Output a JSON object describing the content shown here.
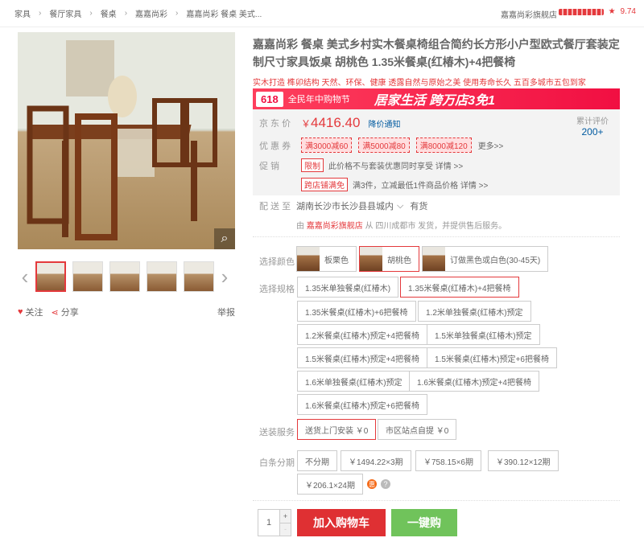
{
  "breadcrumb": [
    "家具",
    "餐厅家具",
    "餐桌",
    "嘉嘉尚彩",
    "嘉嘉尚彩 餐桌 美式..."
  ],
  "shop": {
    "name": "嘉嘉尚彩旗舰店",
    "score": "9.74"
  },
  "product": {
    "title": "嘉嘉尚彩 餐桌 美式乡村实木餐桌椅组合简约长方形小户型欧式餐厅套装定制尺寸家具饭桌 胡桃色 1.35米餐桌(红椿木)+4把餐椅",
    "slogan": "实木打造 榫卯结构 天然、环保、健康 透露自然与原始之美 使用寿命长久 五百多城市五包到家"
  },
  "banner": {
    "badge": "618",
    "sub": "全民年中购物节",
    "main": "居家生活 跨万店3免1"
  },
  "price": {
    "label": "京 东 价",
    "currency": "￥",
    "value": "4416.40",
    "notify": "降价通知",
    "comments_label": "累计评价",
    "comments": "200+",
    "coupon_label": "优 惠 券",
    "coupons": [
      "满3000减60",
      "满5000减80",
      "满8000减120"
    ],
    "more": "更多>>",
    "promo_label": "促 销",
    "promos": [
      {
        "tag": "限制",
        "text": "此价格不与套装优惠同时享受  详情 >>"
      },
      {
        "tag": "跨店铺满免",
        "text": "满3件，立减最低1件商品价格  详情 >>"
      }
    ]
  },
  "shipping": {
    "label": "配 送 至",
    "location": "湖南长沙市长沙县县城内",
    "stock": "有货",
    "by_prefix": "由",
    "shop": "嘉嘉尚彩旗舰店",
    "by_suffix": "从 四川成都市 发货，并提供售后服务。"
  },
  "colors": {
    "label": "选择颜色",
    "options": [
      "板栗色",
      "胡桃色",
      "订做黑色或白色(30-45天)"
    ],
    "selected": "胡桃色"
  },
  "specs": {
    "label": "选择规格",
    "options": [
      "1.35米单独餐桌(红椿木)",
      "1.35米餐桌(红椿木)+4把餐椅",
      "1.35米餐桌(红椿木)+6把餐椅",
      "1.2米单独餐桌(红椿木)预定",
      "1.2米餐桌(红椿木)预定+4把餐椅",
      "1.5米单独餐桌(红椿木)预定",
      "1.5米餐桌(红椿木)预定+4把餐椅",
      "1.5米餐桌(红椿木)预定+6把餐椅",
      "1.6米单独餐桌(红椿木)预定",
      "1.6米餐桌(红椿木)预定+4把餐椅",
      "1.6米餐桌(红椿木)预定+6把餐椅"
    ],
    "selected": "1.35米餐桌(红椿木)+4把餐椅"
  },
  "service": {
    "label": "送装服务",
    "options": [
      "送货上门安装 ￥0",
      "市区站点自提 ￥0"
    ]
  },
  "installment": {
    "label": "白条分期",
    "options": [
      "不分期",
      "￥1494.22×3期",
      "￥758.15×6期",
      "￥390.12×12期",
      "￥206.1×24期"
    ],
    "hui": "惠",
    "help": "?"
  },
  "actions": {
    "follow": "关注",
    "share": "分享",
    "report": "举报",
    "qty": "1",
    "plus": "+",
    "minus": "-",
    "add_cart": "加入购物车",
    "buy_now": "一键购"
  },
  "accent_color": "#e4393c"
}
